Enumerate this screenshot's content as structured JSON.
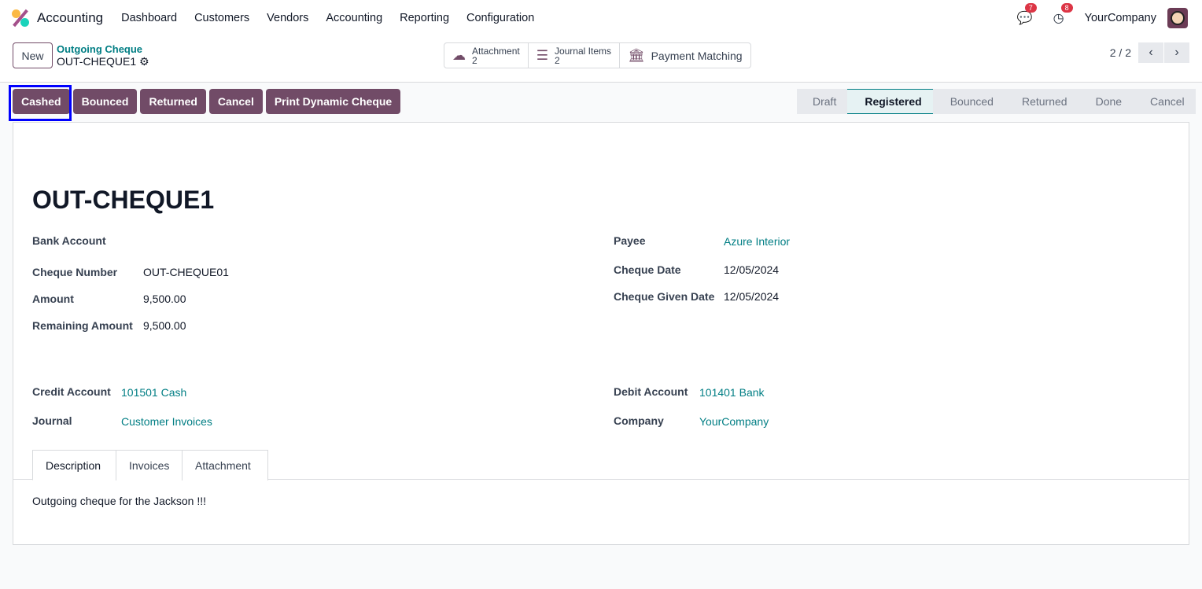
{
  "nav": {
    "app": "Accounting",
    "menu": [
      "Dashboard",
      "Customers",
      "Vendors",
      "Accounting",
      "Reporting",
      "Configuration"
    ],
    "messages_count": "7",
    "activities_count": "8",
    "company": "YourCompany"
  },
  "control": {
    "new_label": "New",
    "breadcrumb_parent": "Outgoing Cheque",
    "record_name": "OUT-CHEQUE1",
    "pager": "2 / 2",
    "smart_buttons": [
      {
        "label": "Attachment",
        "count": "2"
      },
      {
        "label": "Journal Items",
        "count": "2"
      },
      {
        "label": "Payment Matching"
      }
    ]
  },
  "actions": [
    "Cashed",
    "Bounced",
    "Returned",
    "Cancel",
    "Print Dynamic Cheque"
  ],
  "statusbar": {
    "stages": [
      "Draft",
      "Registered",
      "Bounced",
      "Returned",
      "Done",
      "Cancel"
    ],
    "active": "Registered"
  },
  "form": {
    "title": "OUT-CHEQUE1",
    "bank_account_label": "Bank Account",
    "cheque_number_label": "Cheque Number",
    "cheque_number": "OUT-CHEQUE01",
    "amount_label": "Amount",
    "amount": "9,500.00",
    "remaining_label": "Remaining Amount",
    "remaining": "9,500.00",
    "payee_label": "Payee",
    "payee": "Azure Interior",
    "cheque_date_label": "Cheque Date",
    "cheque_date": "12/05/2024",
    "given_date_label": "Cheque Given Date",
    "given_date": "12/05/2024",
    "credit_label": "Credit Account",
    "credit": "101501 Cash",
    "journal_label": "Journal",
    "journal": "Customer Invoices",
    "debit_label": "Debit Account",
    "debit": "101401 Bank",
    "company_label": "Company",
    "company": "YourCompany",
    "tabs": [
      "Description",
      "Invoices",
      "Attachment"
    ],
    "description": "Outgoing cheque for the Jackson !!!"
  },
  "colors": {
    "primary": "#714b67",
    "link": "#017e84"
  }
}
